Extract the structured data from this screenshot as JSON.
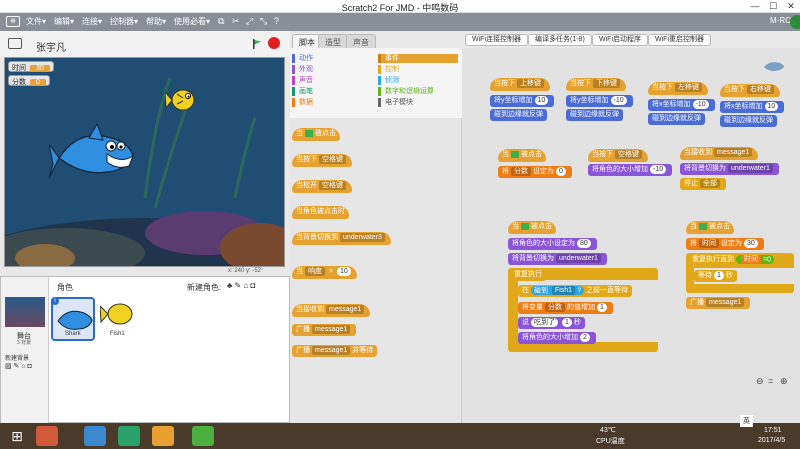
{
  "window": {
    "title": "Scratch2 For JMD - 中鸣数码"
  },
  "menu": {
    "items": [
      "文件▾",
      "编辑▾",
      "连接▾",
      "控制器▾",
      "帮助▾",
      "使用必看▾"
    ],
    "right": "M-RCU"
  },
  "stage": {
    "project_name": "张宇凡",
    "var1_label": "时间",
    "var1_value": "30",
    "var2_label": "分数",
    "var2_value": "0",
    "coords": "x: 240   y: -52"
  },
  "sprites": {
    "header": "角色",
    "new_sprite": "新建角色:",
    "stage_label": "舞台",
    "stage_bg": "3 背景",
    "new_bg": "新建背景",
    "items": [
      {
        "name": "Shark"
      },
      {
        "name": "Fish1"
      }
    ]
  },
  "tabs": [
    "脚本",
    "造型",
    "声音"
  ],
  "categories": {
    "left": [
      "动作",
      "外观",
      "声音",
      "画笔",
      "数据"
    ],
    "right": [
      "事件",
      "控制",
      "侦测",
      "数字和逻辑运算",
      "电子模块"
    ]
  },
  "top_buttons": [
    "WiFi连接控制器",
    "编译多任务(1-8)",
    "WiFi启动程序",
    "WiFi重启控制器"
  ],
  "palette": {
    "b1": "当",
    "b1b": "被点击",
    "b2": "当按下",
    "b2d": "空格键",
    "b3": "当松开",
    "b3d": "空格键",
    "b4": "当角色被点击时",
    "b5": "当背景切换到",
    "b5d": "underwater3",
    "b6": "当",
    "b6d": "响度",
    "b6v": "10",
    "b7": "当接收到",
    "b7d": "message1",
    "b8": "广播",
    "b8d": "message1",
    "b9": "广播",
    "b9d": "message1",
    "b9e": "并等待"
  },
  "scripts": {
    "s1h": "当按下",
    "s1d": "上移键",
    "s1a": "将y坐标增加",
    "s1v": "10",
    "s1b": "碰到边缘就反弹",
    "s2h": "当按下",
    "s2d": "下移键",
    "s2a": "将y坐标增加",
    "s2v": "-10",
    "s2b": "碰到边缘就反弹",
    "s3h": "当按下",
    "s3d": "左移键",
    "s3a": "将x坐标增加",
    "s3v": "-10",
    "s3b": "碰到边缘就反弹",
    "s4h": "当按下",
    "s4d": "右移键",
    "s4a": "将x坐标增加",
    "s4v": "10",
    "s4b": "碰到边缘就反弹",
    "s5h": "当",
    "s5h2": "被点击",
    "s5a": "将",
    "s5d": "分数",
    "s5e": "设定为",
    "s5v": "0",
    "s6h": "当按下",
    "s6d": "空格键",
    "s6a": "将角色的大小增加",
    "s6v": "-10",
    "s7h": "当接收到",
    "s7d": "message1",
    "s7a": "将背景切换为",
    "s7ad": "underwater1",
    "s7b": "停止",
    "s7bd": "全部",
    "s8h": "当",
    "s8h2": "被点击",
    "s8a": "将角色的大小设定为",
    "s8v": "80",
    "s8b": "将背景切换为",
    "s8bd": "underwater1",
    "s8c": "重复执行",
    "s8d": "在",
    "s8e": "碰到",
    "s8ed": "Fish1",
    "s8f": "?",
    "s8g": "之前一直等待",
    "s8h3": "将变量",
    "s8hd": "分数",
    "s8h4": "的值增加",
    "s8hv": "1",
    "s8i": "说",
    "s8iv": "吃到了",
    "s8i2": "1",
    "s8i3": "秒",
    "s8j": "将角色的大小增加",
    "s8jv": "2",
    "s9h": "当",
    "s9h2": "被点击",
    "s9a": "将",
    "s9ad": "时间",
    "s9a2": "设定为",
    "s9av": "30",
    "s9b": "重复执行直到",
    "s9bd": "时间",
    "s9b2": "=",
    "s9bv": "0",
    "s9c": "等待",
    "s9cv": "1",
    "s9c2": "秒",
    "s9d": "广播",
    "s9dd": "message1"
  },
  "taskbar": {
    "temp": "43℃",
    "temp_label": "CPU温度",
    "lang": "英",
    "time": "17:51",
    "date": "2017/4/5"
  }
}
